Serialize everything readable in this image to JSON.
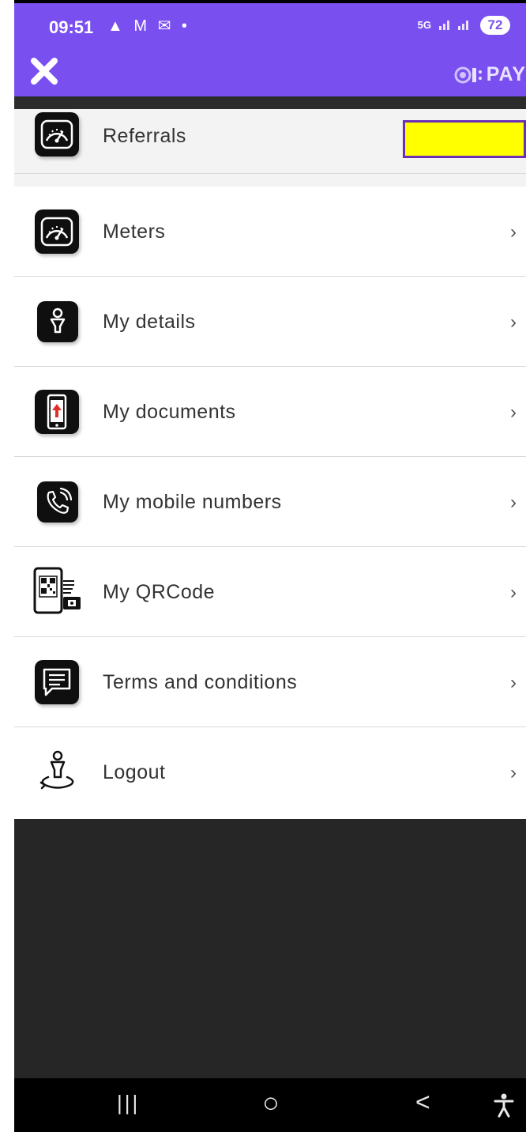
{
  "status_bar": {
    "time": "09:51",
    "left_icons": "▲ M ✉ •",
    "network_type": "5G",
    "battery_level": "72"
  },
  "header": {
    "close_icon": "x-icon",
    "brand_text": "PAY",
    "accent_color": "#7a4ff0"
  },
  "referrals": {
    "label": "Referrals",
    "highlight_color": "#ffff00"
  },
  "menu": {
    "items": [
      {
        "label": "Meters",
        "icon": "speedometer-icon"
      },
      {
        "label": "My details",
        "icon": "person-icon"
      },
      {
        "label": "My documents",
        "icon": "phone-upload-icon"
      },
      {
        "label": "My mobile numbers",
        "icon": "phone-call-icon"
      },
      {
        "label": "My QRCode",
        "icon": "qrcode-icon"
      },
      {
        "label": "Terms and conditions",
        "icon": "message-icon"
      },
      {
        "label": "Logout",
        "icon": "logout-person-icon"
      }
    ],
    "chevron": "›"
  },
  "nav_bar": {
    "recents": "|||",
    "home": "○",
    "back": "<",
    "accessibility_icon": "accessibility-icon"
  }
}
